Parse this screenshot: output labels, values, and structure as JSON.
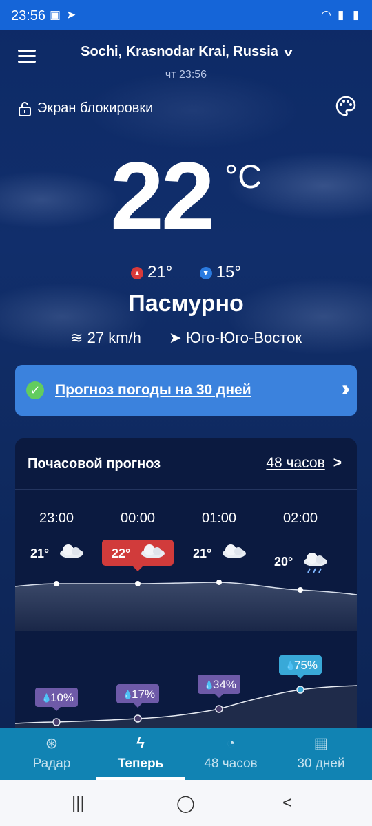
{
  "status_bar": {
    "time": "23:56"
  },
  "header": {
    "location": "Sochi, Krasnodar Krai, Russia",
    "local_time": "чт 23:56",
    "lock_screen_label": "Экран блокировки"
  },
  "current": {
    "temperature": "22",
    "unit": "°C",
    "high": "21°",
    "low": "15°",
    "condition": "Пасмурно",
    "wind_speed": "27 km/h",
    "wind_direction": "Юго-Юго-Восток"
  },
  "banner": {
    "label": "Прогноз погоды на 30 дней"
  },
  "hourly": {
    "title": "Почасовой прогноз",
    "more_label": "48 часов",
    "hours": [
      {
        "time": "23:00",
        "temp": "21°",
        "icon": "cloud-icon",
        "precip": "10%"
      },
      {
        "time": "00:00",
        "temp": "22°",
        "icon": "cloud-icon",
        "precip": "17%"
      },
      {
        "time": "01:00",
        "temp": "21°",
        "icon": "cloud-icon",
        "precip": "34%"
      },
      {
        "time": "02:00",
        "temp": "20°",
        "icon": "rain-cloud-icon",
        "precip": "75%"
      }
    ]
  },
  "bottom_nav": [
    {
      "label": "Радар",
      "icon": "radar-icon"
    },
    {
      "label": "Теперь",
      "icon": "lightning-icon",
      "active": true
    },
    {
      "label": "48 часов",
      "icon": "clock-icon"
    },
    {
      "label": "30 дней",
      "icon": "calendar-icon"
    }
  ],
  "colors": {
    "accent_blue": "#3b82dd",
    "highlight_red": "#d13b3b",
    "precip_purple": "#6e5aa8",
    "precip_highlight": "#39a9d8",
    "nav_bg": "#1183b3"
  }
}
